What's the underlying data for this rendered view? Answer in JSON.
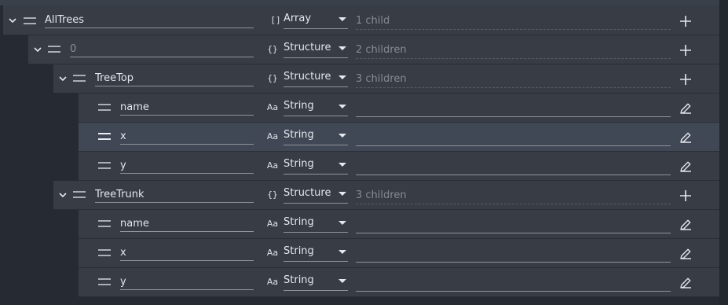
{
  "rows": [
    {
      "name": "AllTrees",
      "type": "Array",
      "type_icon": "[]",
      "value": "1 child",
      "action": "plus-icon"
    },
    {
      "name": "0",
      "type": "Structure",
      "type_icon": "{}",
      "value": "2 children",
      "action": "plus-icon"
    },
    {
      "name": "TreeTop",
      "type": "Structure",
      "type_icon": "{}",
      "value": "3 children",
      "action": "plus-icon"
    },
    {
      "name": "name",
      "type": "String",
      "type_icon": "Aa",
      "value": "",
      "action": "pencil-icon"
    },
    {
      "name": "x",
      "type": "String",
      "type_icon": "Aa",
      "value": "",
      "action": "pencil-icon"
    },
    {
      "name": "y",
      "type": "String",
      "type_icon": "Aa",
      "value": "",
      "action": "pencil-icon"
    },
    {
      "name": "TreeTrunk",
      "type": "Structure",
      "type_icon": "{}",
      "value": "3 children",
      "action": "plus-icon"
    },
    {
      "name": "name",
      "type": "String",
      "type_icon": "Aa",
      "value": "",
      "action": "pencil-icon"
    },
    {
      "name": "x",
      "type": "String",
      "type_icon": "Aa",
      "value": "",
      "action": "pencil-icon"
    },
    {
      "name": "y",
      "type": "String",
      "type_icon": "Aa",
      "value": "",
      "action": "pencil-icon"
    }
  ],
  "selected_row": 4,
  "colors": {
    "background": "#252a33",
    "row": "#373c45",
    "row_selected": "#414855",
    "text": "#e4e7ec",
    "muted": "#858a94"
  }
}
